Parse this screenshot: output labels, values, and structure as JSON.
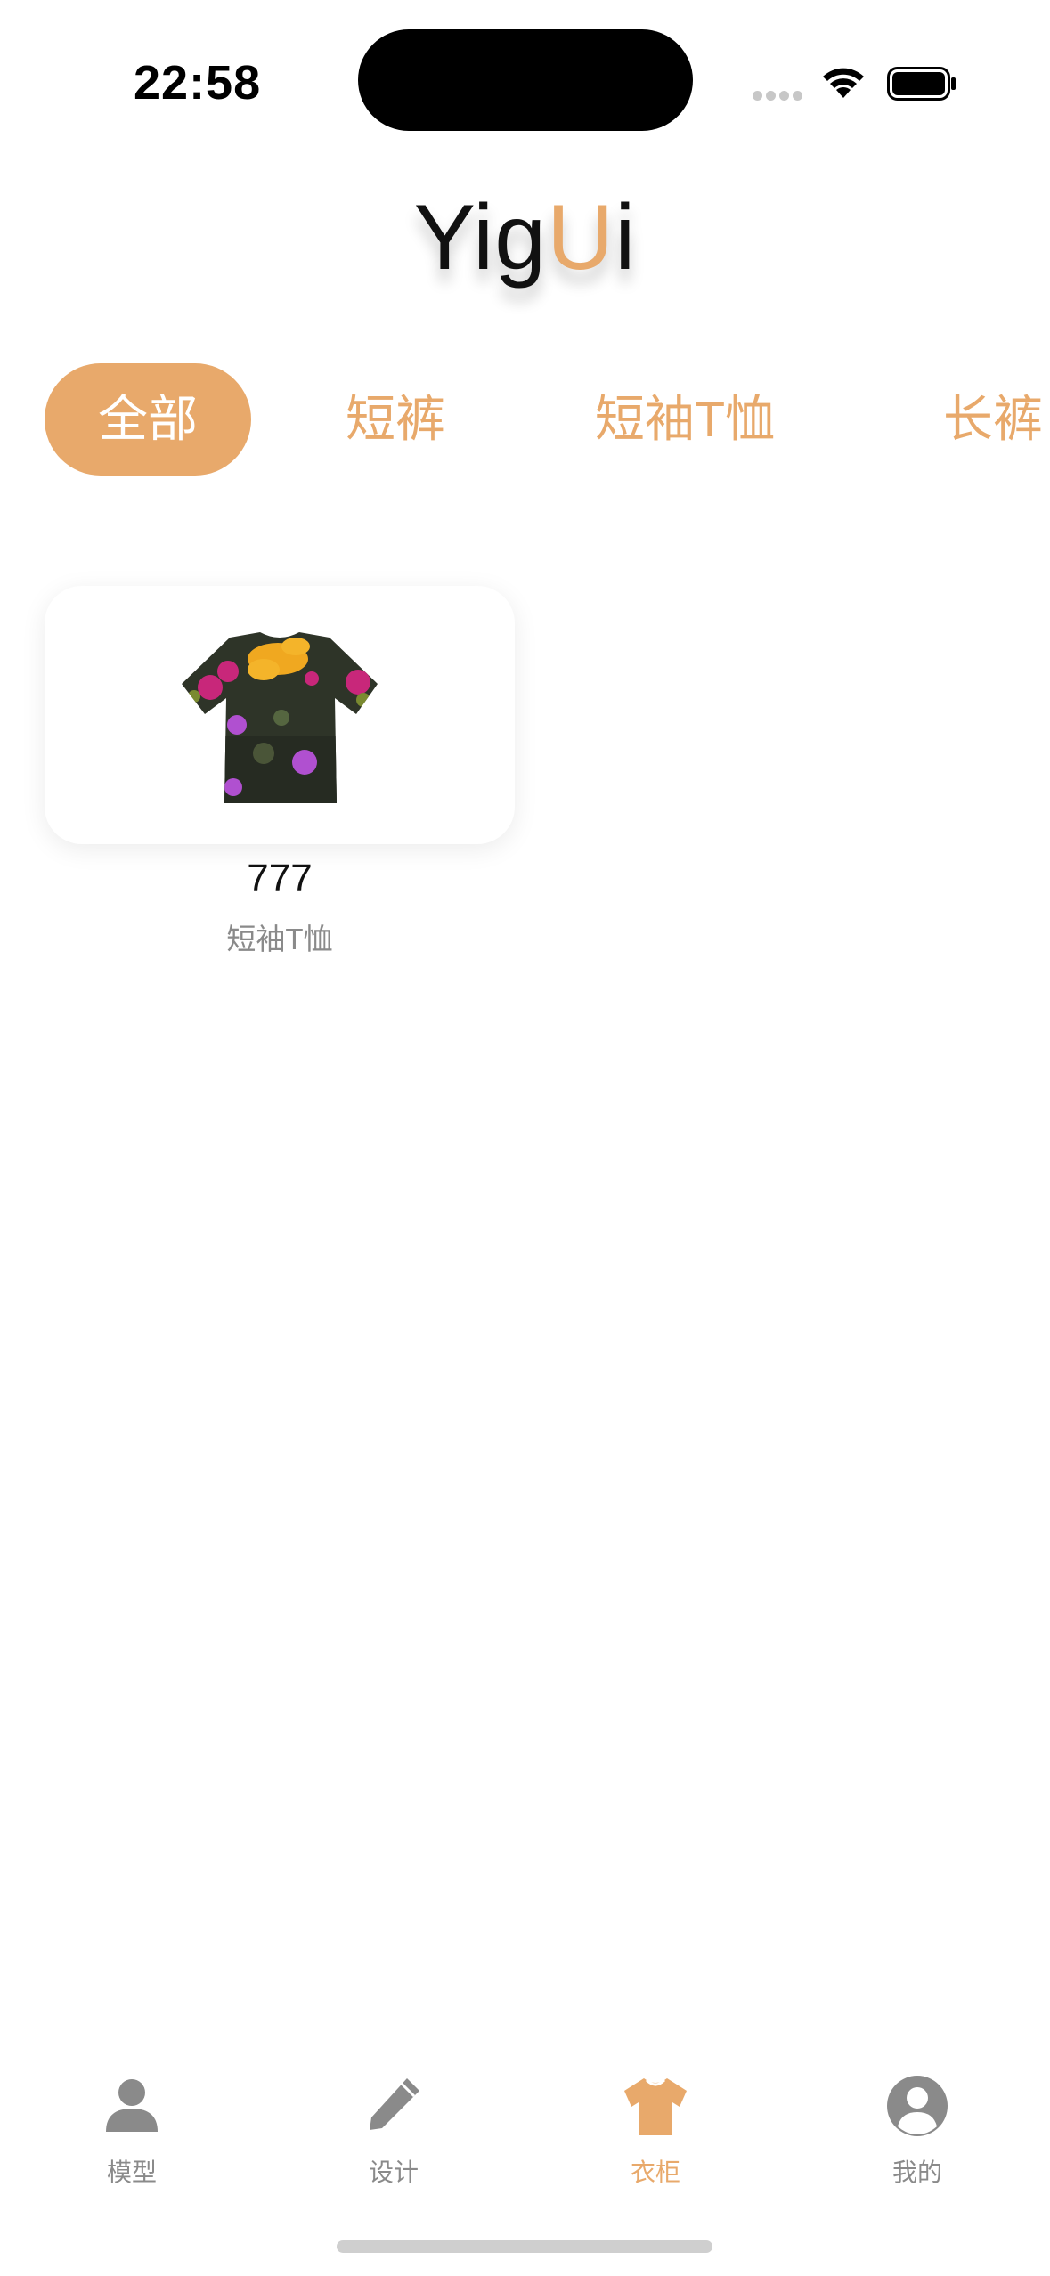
{
  "status": {
    "time": "22:58"
  },
  "app": {
    "title_prefix": "Yig",
    "title_accent": "U",
    "title_suffix": "i",
    "accent_color": "#E8A96B"
  },
  "categories": [
    {
      "label": "全部",
      "active": true
    },
    {
      "label": "短裤",
      "active": false
    },
    {
      "label": "短袖T恤",
      "active": false
    },
    {
      "label": "长裤",
      "active": false
    }
  ],
  "items": [
    {
      "name": "777",
      "category": "短袖T恤",
      "image_icon": "floral-tshirt-image"
    }
  ],
  "tabs": [
    {
      "label": "模型",
      "icon": "person-icon",
      "active": false
    },
    {
      "label": "设计",
      "icon": "pencil-icon",
      "active": false
    },
    {
      "label": "衣柜",
      "icon": "tshirt-icon",
      "active": true
    },
    {
      "label": "我的",
      "icon": "profile-circle-icon",
      "active": false
    }
  ]
}
